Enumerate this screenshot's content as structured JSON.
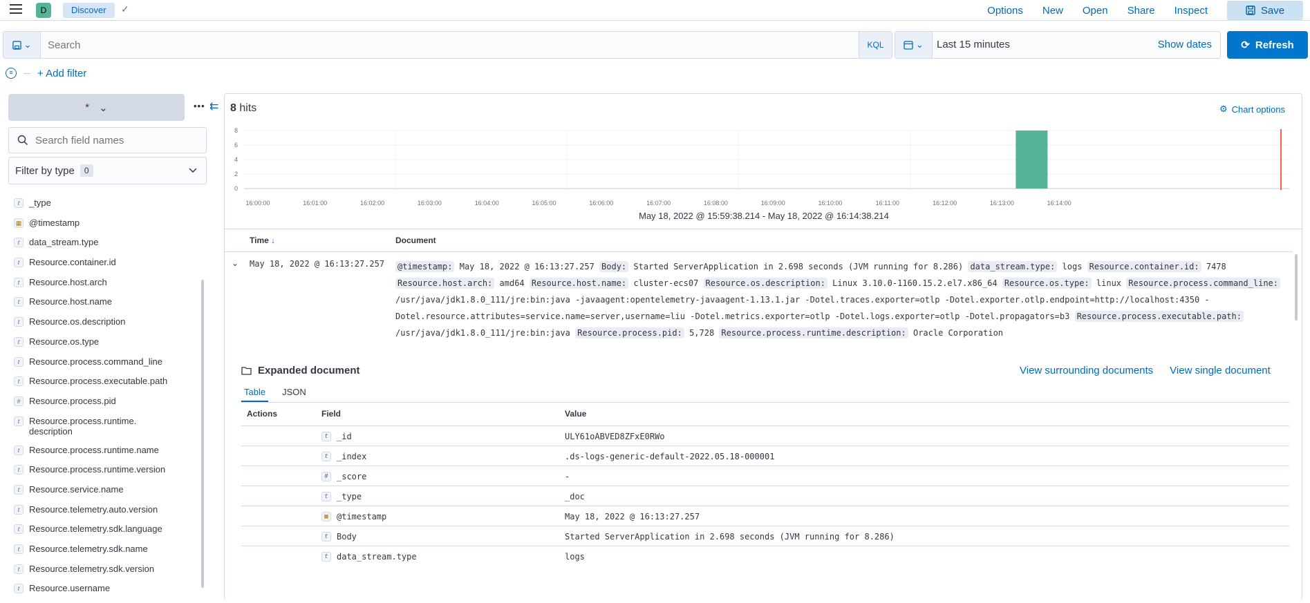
{
  "header": {
    "space_initial": "D",
    "breadcrumb": "Discover",
    "links": [
      "Options",
      "New",
      "Open",
      "Share",
      "Inspect"
    ],
    "save_label": "Save"
  },
  "query": {
    "placeholder": "Search",
    "language": "KQL",
    "date_range": "Last 15 minutes",
    "show_dates": "Show dates",
    "refresh_label": "Refresh",
    "add_filter": "+ Add filter"
  },
  "sidebar": {
    "index_pattern": "*",
    "search_placeholder": "Search field names",
    "filter_by_type": "Filter by type",
    "filter_count": "0",
    "fields": [
      {
        "type": "t",
        "name": "_type"
      },
      {
        "type": "date",
        "name": "@timestamp"
      },
      {
        "type": "t",
        "name": "data_stream.type"
      },
      {
        "type": "t",
        "name": "Resource.container.id"
      },
      {
        "type": "t",
        "name": "Resource.host.arch"
      },
      {
        "type": "t",
        "name": "Resource.host.name"
      },
      {
        "type": "t",
        "name": "Resource.os.description"
      },
      {
        "type": "t",
        "name": "Resource.os.type"
      },
      {
        "type": "t",
        "name": "Resource.process.command_line"
      },
      {
        "type": "t",
        "name": "Resource.process.executable.path"
      },
      {
        "type": "#",
        "name": "Resource.process.pid"
      },
      {
        "type": "t",
        "name": "Resource.process.runtime.description",
        "line1": "Resource.process.runtime.",
        "line2": "description"
      },
      {
        "type": "t",
        "name": "Resource.process.runtime.name"
      },
      {
        "type": "t",
        "name": "Resource.process.runtime.version"
      },
      {
        "type": "t",
        "name": "Resource.service.name"
      },
      {
        "type": "t",
        "name": "Resource.telemetry.auto.version"
      },
      {
        "type": "t",
        "name": "Resource.telemetry.sdk.language"
      },
      {
        "type": "t",
        "name": "Resource.telemetry.sdk.name"
      },
      {
        "type": "t",
        "name": "Resource.telemetry.sdk.version"
      },
      {
        "type": "t",
        "name": "Resource.username"
      }
    ]
  },
  "hits": {
    "count": "8",
    "label": "hits",
    "chart_options": "Chart options",
    "range": "May 18, 2022 @ 15:59:38.214 - May 18, 2022 @ 16:14:38.214"
  },
  "chart_data": {
    "type": "bar",
    "categories": [
      "16:00:00",
      "16:01:00",
      "16:02:00",
      "16:03:00",
      "16:04:00",
      "16:05:00",
      "16:06:00",
      "16:07:00",
      "16:08:00",
      "16:09:00",
      "16:10:00",
      "16:11:00",
      "16:12:00",
      "16:13:00",
      "16:14:00"
    ],
    "values": [
      0,
      0,
      0,
      0,
      0,
      0,
      0,
      0,
      0,
      0,
      0,
      0,
      0,
      8,
      0
    ],
    "y_ticks": [
      0,
      2,
      4,
      6,
      8
    ],
    "ylim": [
      0,
      8
    ],
    "bar_color": "#54b399",
    "now_marker_color": "#e7664c"
  },
  "table": {
    "time_header": "Time",
    "sort_indicator": "↓",
    "document_header": "Document",
    "row_time": "May 18, 2022 @ 16:13:27.257",
    "row_doc": [
      {
        "k": "@timestamp:",
        "v": "May 18, 2022 @ 16:13:27.257"
      },
      {
        "k": "Body:",
        "v": "Started ServerApplication in 2.698 seconds (JVM running for 8.286)"
      },
      {
        "k": "data_stream.type:",
        "v": "logs"
      },
      {
        "k": "Resource.container.id:",
        "v": "7478"
      },
      {
        "k": "Resource.host.arch:",
        "v": "amd64"
      },
      {
        "k": "Resource.host.name:",
        "v": "cluster-ecs07"
      },
      {
        "k": "Resource.os.description:",
        "v": "Linux 3.10.0-1160.15.2.el7.x86_64"
      },
      {
        "k": "Resource.os.type:",
        "v": "linux"
      },
      {
        "k": "Resource.process.command_line:",
        "v": "/usr/java/jdk1.8.0_111/jre:bin:java -javaagent:opentelemetry-javaagent-1.13.1.jar -Dotel.traces.exporter=otlp -Dotel.exporter.otlp.endpoint=http://localhost:4350 -Dotel.resource.attributes=service.name=server,username=liu -Dotel.metrics.exporter=otlp -Dotel.logs.exporter=otlp -Dotel.propagators=b3"
      },
      {
        "k": "Resource.process.executable.path:",
        "v": "/usr/java/jdk1.8.0_111/jre:bin:java"
      },
      {
        "k": "Resource.process.pid:",
        "v": "5,728"
      },
      {
        "k": "Resource.process.runtime.description:",
        "v": "Oracle Corporation"
      }
    ]
  },
  "expanded": {
    "title": "Expanded document",
    "surrounding": "View surrounding documents",
    "single": "View single document",
    "tabs": [
      "Table",
      "JSON"
    ],
    "columns": [
      "Actions",
      "Field",
      "Value"
    ],
    "rows": [
      {
        "type": "t",
        "field": "_id",
        "value": "ULY61oABVED8ZFxE0RWo"
      },
      {
        "type": "t",
        "field": "_index",
        "value": ".ds-logs-generic-default-2022.05.18-000001"
      },
      {
        "type": "#",
        "field": "_score",
        "value": " -"
      },
      {
        "type": "t",
        "field": "_type",
        "value": "_doc"
      },
      {
        "type": "date",
        "field": "@timestamp",
        "value": "May 18, 2022 @ 16:13:27.257"
      },
      {
        "type": "t",
        "field": "Body",
        "value": "Started ServerApplication in 2.698 seconds (JVM running for 8.286)"
      },
      {
        "type": "t",
        "field": "data_stream.type",
        "value": "logs"
      }
    ]
  }
}
